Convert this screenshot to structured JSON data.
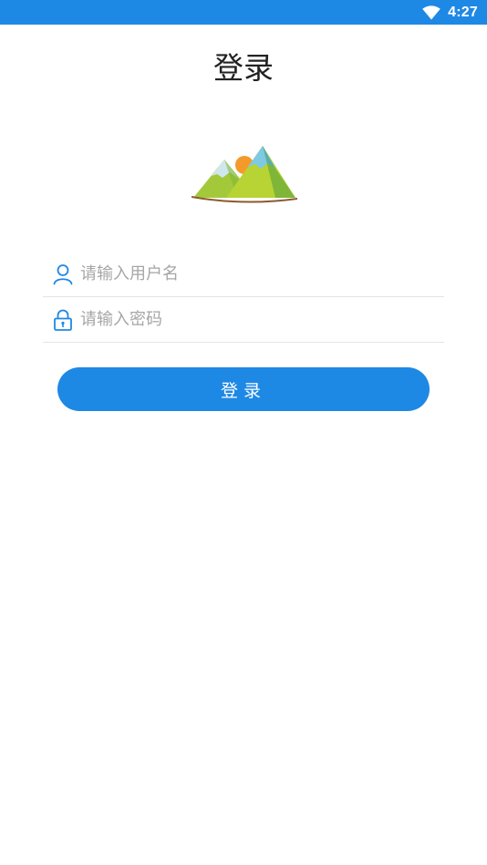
{
  "status_bar": {
    "time": "4:27",
    "wifi_icon": "wifi-icon",
    "background_color": "#1e88e5"
  },
  "title": "登录",
  "logo": {
    "icon": "mountain-sun-logo"
  },
  "form": {
    "username": {
      "icon": "user-icon",
      "placeholder": "请输入用户名",
      "value": ""
    },
    "password": {
      "icon": "lock-icon",
      "placeholder": "请输入密码",
      "value": ""
    }
  },
  "login_button": {
    "label": "登录",
    "color": "#1e88e5"
  },
  "accent_color": "#1e88e5"
}
